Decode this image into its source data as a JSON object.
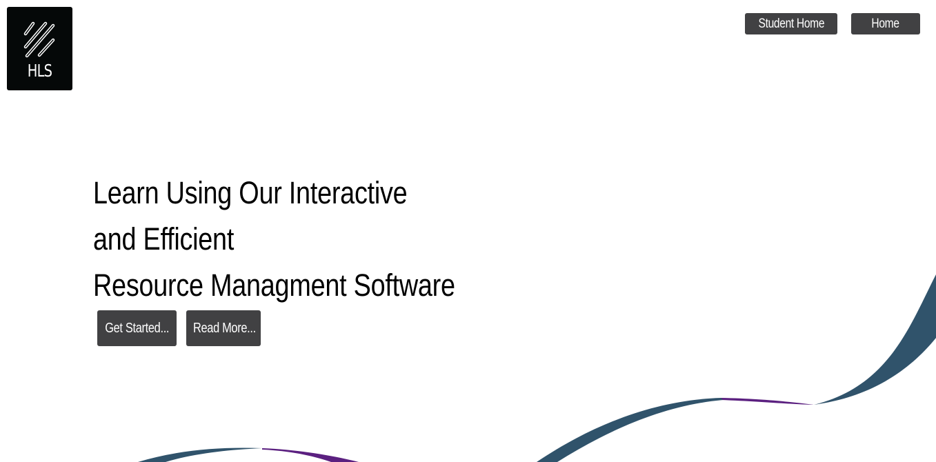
{
  "logo": {
    "text": "HLS",
    "icon": "diagonal-lines-icon"
  },
  "nav": {
    "student_home": "Student Home",
    "home": "Home"
  },
  "hero": {
    "line1": "Learn Using Our Interactive",
    "line2": "and Efficient",
    "line3": "Resource Managment Software"
  },
  "cta": {
    "get_started": "Get Started...",
    "read_more": "Read More..."
  },
  "colors": {
    "button_bg": "#414143",
    "ribbon_blue": "#30536b",
    "ribbon_purple": "#5b2080"
  }
}
